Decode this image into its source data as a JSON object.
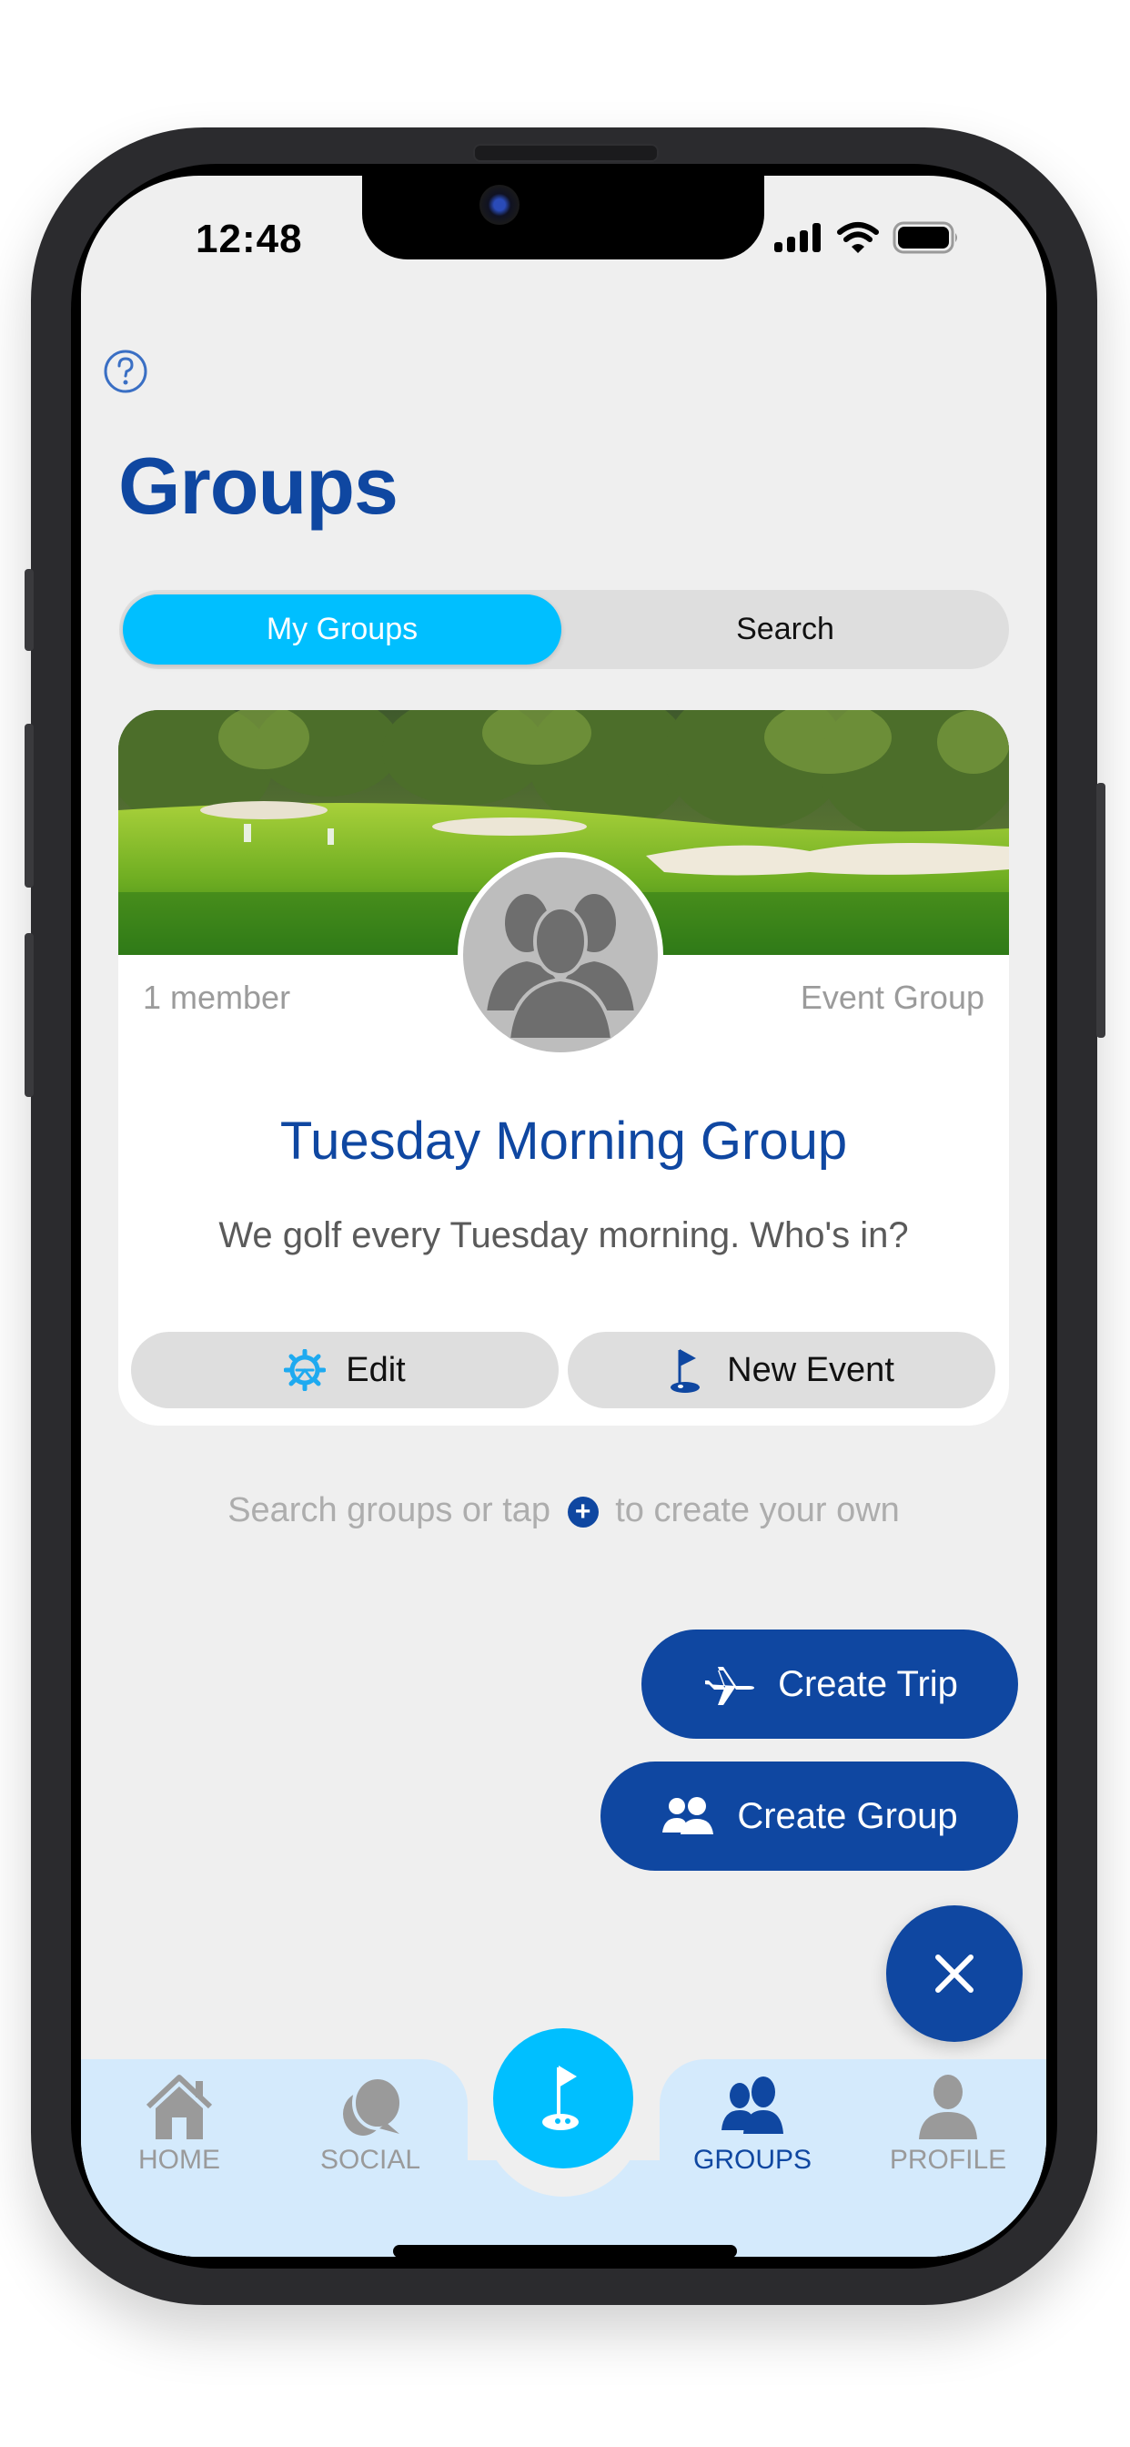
{
  "status_bar": {
    "time": "12:48",
    "icons": [
      "signal-icon",
      "wifi-icon",
      "battery-icon"
    ],
    "battery_level": 1.0
  },
  "header": {
    "help_icon": "question-circle-icon",
    "title": "Groups"
  },
  "segmented_control": {
    "tabs": [
      {
        "label": "My Groups",
        "active": true
      },
      {
        "label": "Search",
        "active": false
      }
    ]
  },
  "group_card": {
    "cover_image": "golf-course-photo",
    "avatar_icon": "group-silhouette-icon",
    "member_count": "1 member",
    "group_type": "Event Group",
    "name": "Tuesday Morning Group",
    "description": "We golf every Tuesday morning. Who's in?",
    "buttons": [
      {
        "label": "Edit",
        "icon": "gear-icon"
      },
      {
        "label": "New Event",
        "icon": "golf-flag-icon"
      }
    ]
  },
  "hint": {
    "before": "Search groups or tap",
    "icon": "plus-circle-icon",
    "after": "to create your own"
  },
  "actions": [
    {
      "label": "Create Trip",
      "icon": "airplane-icon"
    },
    {
      "label": "Create Group",
      "icon": "people-icon"
    }
  ],
  "fab": {
    "icon": "close-icon"
  },
  "tab_bar": {
    "items": [
      {
        "label": "HOME",
        "icon": "house-icon",
        "active": false
      },
      {
        "label": "SOCIAL",
        "icon": "chat-bubbles-icon",
        "active": false
      },
      {
        "label": "GROUPS",
        "icon": "people-icon",
        "active": true
      },
      {
        "label": "PROFILE",
        "icon": "person-icon",
        "active": false
      }
    ],
    "center_icon": "golf-flag-icon"
  },
  "colors": {
    "brand_blue": "#0f47a1",
    "accent_cyan": "#00bfff",
    "tabbar_bg": "#d4eafc",
    "screen_bg": "#efefef"
  }
}
